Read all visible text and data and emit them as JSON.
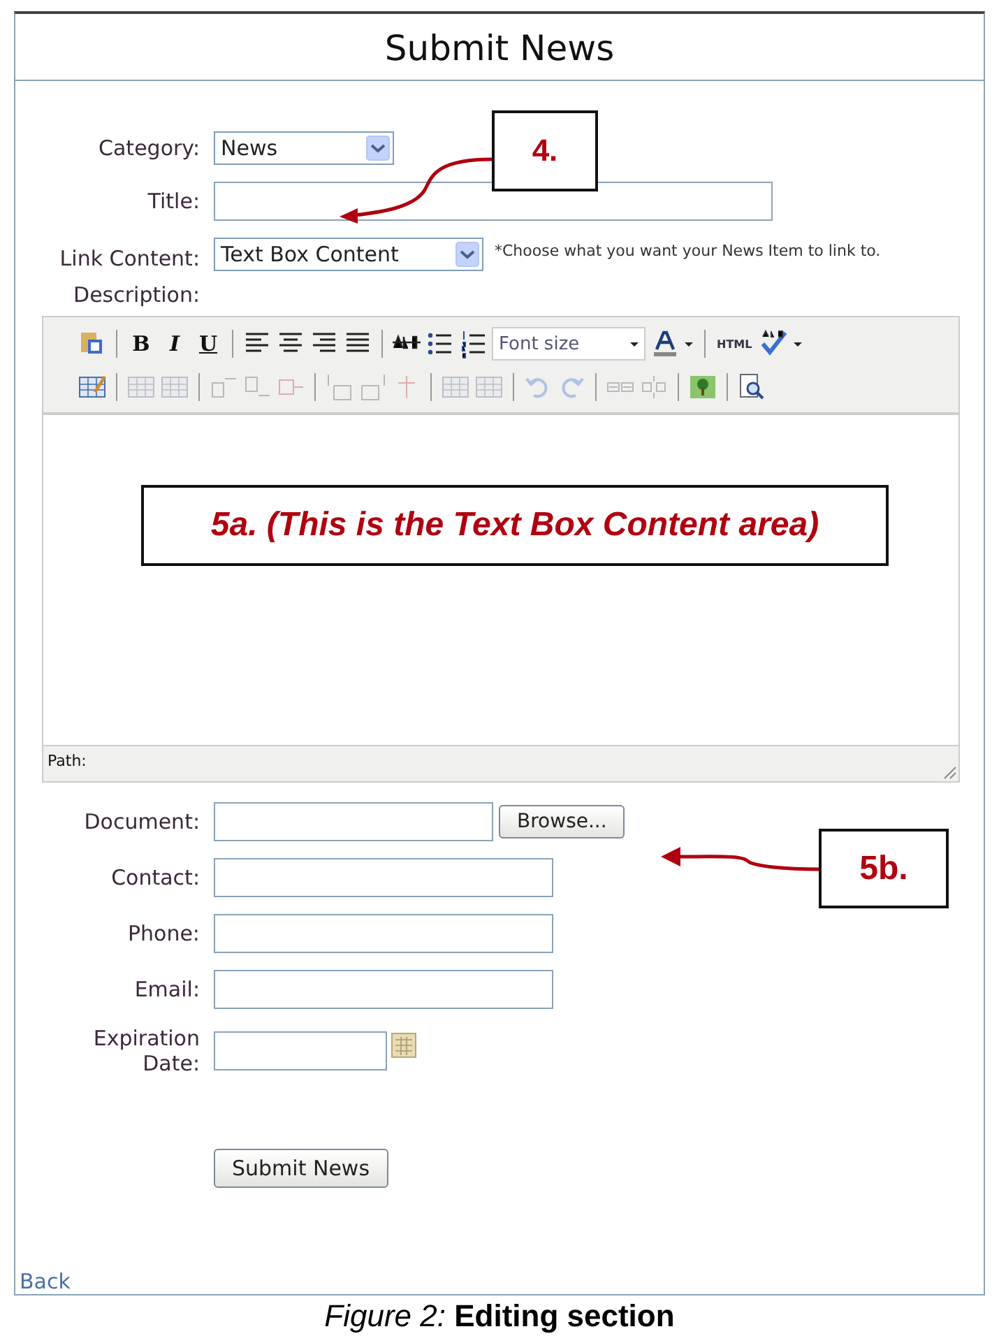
{
  "page_title": "Submit News",
  "form": {
    "category": {
      "label": "Category:",
      "value": "News"
    },
    "title": {
      "label": "Title:"
    },
    "link_content": {
      "label": "Link Content:",
      "value": "Text Box Content",
      "hint": "*Choose what you want your News Item to link to."
    },
    "description": {
      "label": "Description:"
    }
  },
  "editor": {
    "toolbar": [
      {
        "items": [
          {
            "kind": "button",
            "disabled": false
          },
          {
            "kind": "separator"
          },
          {
            "kind": "button",
            "label": "B",
            "disabled": false
          },
          {
            "kind": "button",
            "label": "I",
            "disabled": false
          },
          {
            "kind": "button",
            "label": "U",
            "disabled": false
          },
          {
            "kind": "separator"
          },
          {
            "kind": "button",
            "disabled": false
          },
          {
            "kind": "button",
            "disabled": false
          },
          {
            "kind": "button",
            "disabled": false
          },
          {
            "kind": "button",
            "disabled": false
          },
          {
            "kind": "separator"
          },
          {
            "kind": "button",
            "disabled": false
          },
          {
            "kind": "button",
            "disabled": false
          },
          {
            "kind": "button",
            "disabled": false
          },
          {
            "kind": "select",
            "placeholder": "Font size"
          },
          {
            "kind": "button",
            "disabled": false
          },
          {
            "kind": "separator"
          },
          {
            "kind": "button",
            "label": "HTML",
            "disabled": false
          },
          {
            "kind": "button",
            "disabled": false
          }
        ]
      },
      {
        "items": [
          {
            "kind": "button",
            "disabled": false
          },
          {
            "kind": "separator"
          },
          {
            "kind": "button",
            "disabled": true
          },
          {
            "kind": "button",
            "disabled": true
          },
          {
            "kind": "separator"
          },
          {
            "kind": "button",
            "disabled": true
          },
          {
            "kind": "button",
            "disabled": true
          },
          {
            "kind": "button",
            "disabled": true
          },
          {
            "kind": "separator"
          },
          {
            "kind": "button",
            "disabled": true
          },
          {
            "kind": "button",
            "disabled": true
          },
          {
            "kind": "button",
            "disabled": true
          },
          {
            "kind": "separator"
          },
          {
            "kind": "button",
            "disabled": true
          },
          {
            "kind": "button",
            "disabled": true
          },
          {
            "kind": "separator"
          },
          {
            "kind": "button",
            "disabled": true
          },
          {
            "kind": "button",
            "disabled": true
          },
          {
            "kind": "separator"
          },
          {
            "kind": "button",
            "disabled": true
          },
          {
            "kind": "button",
            "disabled": true
          },
          {
            "kind": "separator"
          },
          {
            "kind": "button",
            "disabled": false
          },
          {
            "kind": "separator"
          },
          {
            "kind": "button",
            "disabled": false
          }
        ]
      }
    ],
    "status": "Path:"
  },
  "fields": [
    {
      "kind": "file",
      "label": "Document:",
      "button": "Browse..."
    },
    {
      "kind": "text",
      "label": "Contact:"
    },
    {
      "kind": "text",
      "label": "Phone:"
    },
    {
      "kind": "text",
      "label": "Email:"
    },
    {
      "kind": "date",
      "label": "Expiration Date:"
    }
  ],
  "submit": "Submit News",
  "back_link": "Back",
  "callouts": [
    {
      "kind": "title",
      "text": "4."
    },
    {
      "kind": "editor",
      "text": "5a. (This is the Text Box Content area)"
    },
    {
      "kind": "browse",
      "text": "5b."
    }
  ],
  "caption": "*Figure 2:* **Editing section**"
}
